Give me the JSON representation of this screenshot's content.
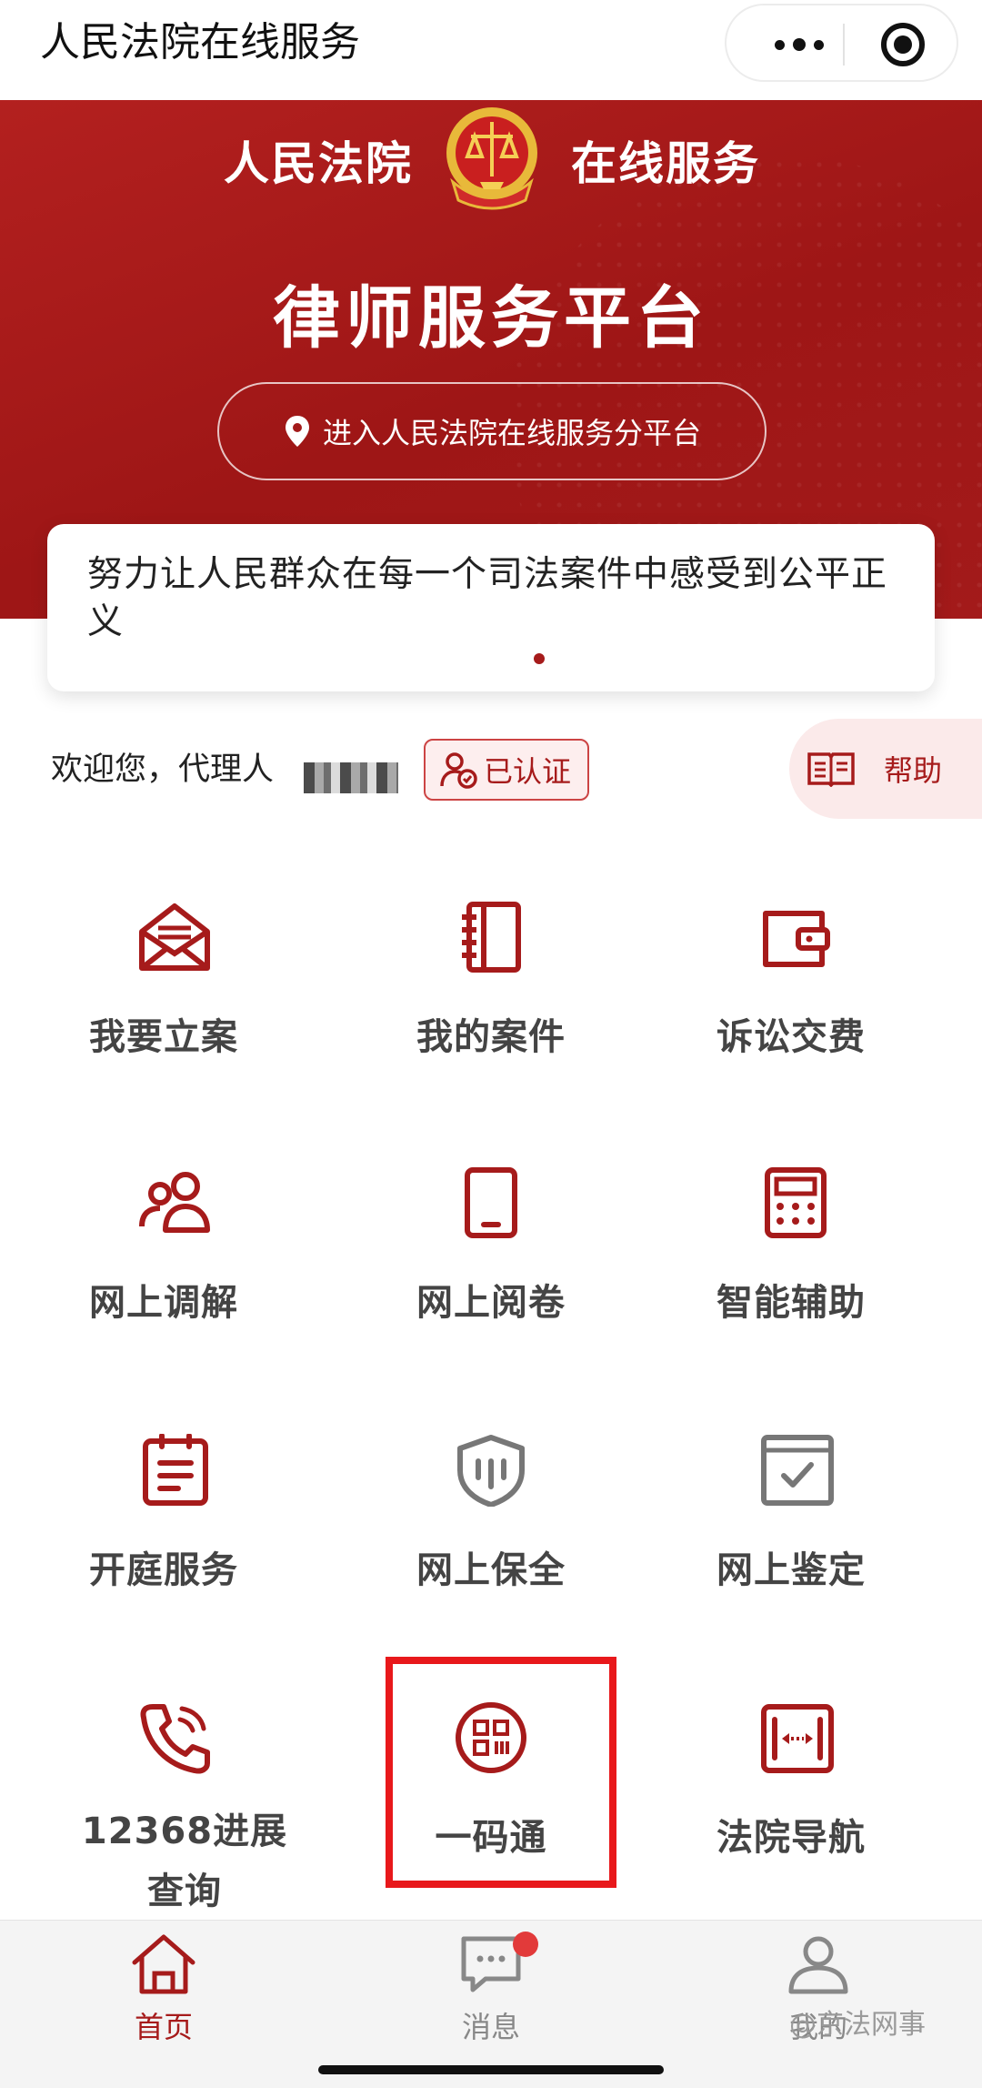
{
  "window": {
    "title": "人民法院在线服务"
  },
  "banner": {
    "head_left": "人民法院",
    "head_right": "在线服务",
    "platform": "律师服务平台",
    "enter_button": "进入人民法院在线服务分平台"
  },
  "slogan": {
    "text": "努力让人民群众在每一个司法案件中感受到公平正义"
  },
  "welcome": {
    "text": "欢迎您，代理人",
    "verified": "已认证",
    "help": "帮助"
  },
  "grid": {
    "items": [
      {
        "label": "我要立案",
        "icon": "envelope-icon"
      },
      {
        "label": "我的案件",
        "icon": "notebook-icon"
      },
      {
        "label": "诉讼交费",
        "icon": "wallet-icon"
      },
      {
        "label": "网上调解",
        "icon": "people-icon"
      },
      {
        "label": "网上阅卷",
        "icon": "tablet-icon"
      },
      {
        "label": "智能辅助",
        "icon": "calculator-icon"
      },
      {
        "label": "开庭服务",
        "icon": "clipboard-icon"
      },
      {
        "label": "网上保全",
        "icon": "shield-icon"
      },
      {
        "label": "网上鉴定",
        "icon": "checkbox-icon"
      },
      {
        "label": "12368进展查询",
        "icon": "phone-icon"
      },
      {
        "label": "一码通",
        "icon": "qrcode-icon"
      },
      {
        "label": "法院导航",
        "icon": "navigation-icon"
      }
    ]
  },
  "tabbar": {
    "items": [
      {
        "label": "首页",
        "icon": "home-icon",
        "active": true
      },
      {
        "label": "消息",
        "icon": "message-icon",
        "active": false
      },
      {
        "label": "我的",
        "icon": "user-icon",
        "active": false
      }
    ]
  },
  "watermark": "@京法网事",
  "colors": {
    "brand_red": "#a61b1b",
    "highlight_red": "#e8181b",
    "icon_gray": "#777777"
  }
}
